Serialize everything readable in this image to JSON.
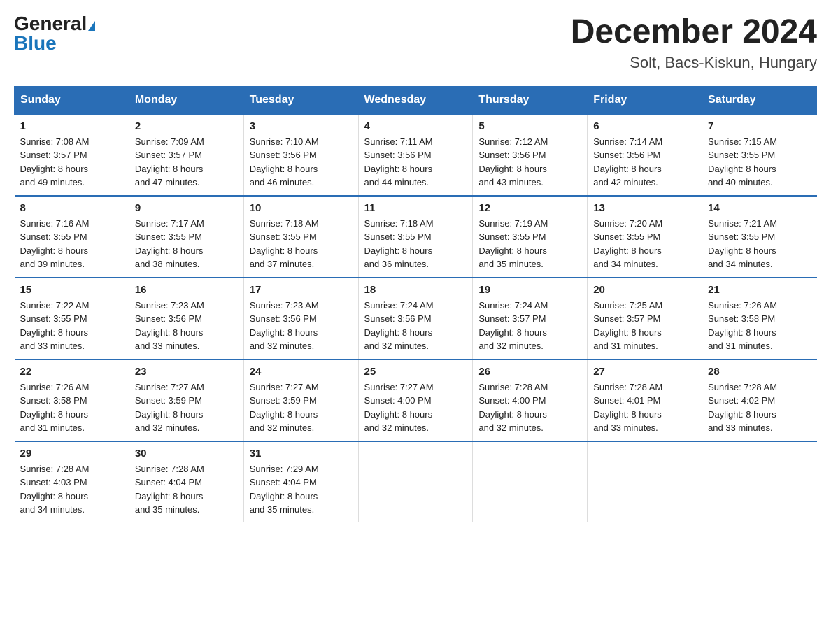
{
  "header": {
    "logo_general": "General",
    "logo_blue": "Blue",
    "month_title": "December 2024",
    "location": "Solt, Bacs-Kiskun, Hungary"
  },
  "days_of_week": [
    "Sunday",
    "Monday",
    "Tuesday",
    "Wednesday",
    "Thursday",
    "Friday",
    "Saturday"
  ],
  "weeks": [
    [
      {
        "day": "1",
        "sunrise": "7:08 AM",
        "sunset": "3:57 PM",
        "daylight": "8 hours and 49 minutes."
      },
      {
        "day": "2",
        "sunrise": "7:09 AM",
        "sunset": "3:57 PM",
        "daylight": "8 hours and 47 minutes."
      },
      {
        "day": "3",
        "sunrise": "7:10 AM",
        "sunset": "3:56 PM",
        "daylight": "8 hours and 46 minutes."
      },
      {
        "day": "4",
        "sunrise": "7:11 AM",
        "sunset": "3:56 PM",
        "daylight": "8 hours and 44 minutes."
      },
      {
        "day": "5",
        "sunrise": "7:12 AM",
        "sunset": "3:56 PM",
        "daylight": "8 hours and 43 minutes."
      },
      {
        "day": "6",
        "sunrise": "7:14 AM",
        "sunset": "3:56 PM",
        "daylight": "8 hours and 42 minutes."
      },
      {
        "day": "7",
        "sunrise": "7:15 AM",
        "sunset": "3:55 PM",
        "daylight": "8 hours and 40 minutes."
      }
    ],
    [
      {
        "day": "8",
        "sunrise": "7:16 AM",
        "sunset": "3:55 PM",
        "daylight": "8 hours and 39 minutes."
      },
      {
        "day": "9",
        "sunrise": "7:17 AM",
        "sunset": "3:55 PM",
        "daylight": "8 hours and 38 minutes."
      },
      {
        "day": "10",
        "sunrise": "7:18 AM",
        "sunset": "3:55 PM",
        "daylight": "8 hours and 37 minutes."
      },
      {
        "day": "11",
        "sunrise": "7:18 AM",
        "sunset": "3:55 PM",
        "daylight": "8 hours and 36 minutes."
      },
      {
        "day": "12",
        "sunrise": "7:19 AM",
        "sunset": "3:55 PM",
        "daylight": "8 hours and 35 minutes."
      },
      {
        "day": "13",
        "sunrise": "7:20 AM",
        "sunset": "3:55 PM",
        "daylight": "8 hours and 34 minutes."
      },
      {
        "day": "14",
        "sunrise": "7:21 AM",
        "sunset": "3:55 PM",
        "daylight": "8 hours and 34 minutes."
      }
    ],
    [
      {
        "day": "15",
        "sunrise": "7:22 AM",
        "sunset": "3:55 PM",
        "daylight": "8 hours and 33 minutes."
      },
      {
        "day": "16",
        "sunrise": "7:23 AM",
        "sunset": "3:56 PM",
        "daylight": "8 hours and 33 minutes."
      },
      {
        "day": "17",
        "sunrise": "7:23 AM",
        "sunset": "3:56 PM",
        "daylight": "8 hours and 32 minutes."
      },
      {
        "day": "18",
        "sunrise": "7:24 AM",
        "sunset": "3:56 PM",
        "daylight": "8 hours and 32 minutes."
      },
      {
        "day": "19",
        "sunrise": "7:24 AM",
        "sunset": "3:57 PM",
        "daylight": "8 hours and 32 minutes."
      },
      {
        "day": "20",
        "sunrise": "7:25 AM",
        "sunset": "3:57 PM",
        "daylight": "8 hours and 31 minutes."
      },
      {
        "day": "21",
        "sunrise": "7:26 AM",
        "sunset": "3:58 PM",
        "daylight": "8 hours and 31 minutes."
      }
    ],
    [
      {
        "day": "22",
        "sunrise": "7:26 AM",
        "sunset": "3:58 PM",
        "daylight": "8 hours and 31 minutes."
      },
      {
        "day": "23",
        "sunrise": "7:27 AM",
        "sunset": "3:59 PM",
        "daylight": "8 hours and 32 minutes."
      },
      {
        "day": "24",
        "sunrise": "7:27 AM",
        "sunset": "3:59 PM",
        "daylight": "8 hours and 32 minutes."
      },
      {
        "day": "25",
        "sunrise": "7:27 AM",
        "sunset": "4:00 PM",
        "daylight": "8 hours and 32 minutes."
      },
      {
        "day": "26",
        "sunrise": "7:28 AM",
        "sunset": "4:00 PM",
        "daylight": "8 hours and 32 minutes."
      },
      {
        "day": "27",
        "sunrise": "7:28 AM",
        "sunset": "4:01 PM",
        "daylight": "8 hours and 33 minutes."
      },
      {
        "day": "28",
        "sunrise": "7:28 AM",
        "sunset": "4:02 PM",
        "daylight": "8 hours and 33 minutes."
      }
    ],
    [
      {
        "day": "29",
        "sunrise": "7:28 AM",
        "sunset": "4:03 PM",
        "daylight": "8 hours and 34 minutes."
      },
      {
        "day": "30",
        "sunrise": "7:28 AM",
        "sunset": "4:04 PM",
        "daylight": "8 hours and 35 minutes."
      },
      {
        "day": "31",
        "sunrise": "7:29 AM",
        "sunset": "4:04 PM",
        "daylight": "8 hours and 35 minutes."
      },
      null,
      null,
      null,
      null
    ]
  ],
  "labels": {
    "sunrise": "Sunrise:",
    "sunset": "Sunset:",
    "daylight": "Daylight:"
  }
}
